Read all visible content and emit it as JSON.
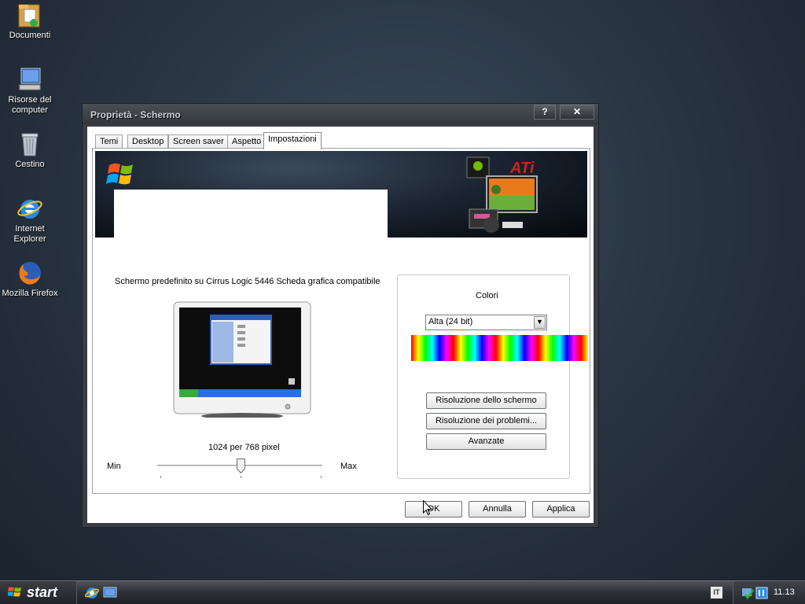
{
  "desktop": {
    "icons": [
      {
        "label": "Documenti",
        "icon": "documents-folder-icon"
      },
      {
        "label": "Risorse del computer",
        "icon": "my-computer-icon"
      },
      {
        "label": "Cestino",
        "icon": "recycle-bin-icon"
      },
      {
        "label": "Internet Explorer",
        "icon": "internet-explorer-icon"
      },
      {
        "label": "Mozilla Firefox",
        "icon": "firefox-icon"
      }
    ]
  },
  "window": {
    "title": "Proprietà - Schermo",
    "help_label": "?",
    "close_label": "✕",
    "tabs": [
      {
        "label": "Temi"
      },
      {
        "label": "Desktop"
      },
      {
        "label": "Screen saver"
      },
      {
        "label": "Aspetto"
      },
      {
        "label": "Impostazioni"
      }
    ],
    "active_tab": "Impostazioni",
    "settings": {
      "device_label": "Schermo predefinito su Cirrus Logic 5446 Scheda grafica compatibile",
      "resolution_text": "1024 per 768 pixel",
      "slider_min": "Min",
      "slider_max": "Max",
      "slider_position": 0.5,
      "colors_group_label": "Colori",
      "color_quality_selected": "Alta (24 bit)",
      "troubleshoot_screen_label": "Risoluzione dello schermo",
      "troubleshoot_problems_label": "Risoluzione dei problemi...",
      "advanced_label": "Avanzate"
    },
    "buttons": {
      "ok": "OK",
      "cancel": "Annulla",
      "apply": "Applica"
    }
  },
  "taskbar": {
    "start_label": "start",
    "language": "IT",
    "clock": "11.13"
  }
}
